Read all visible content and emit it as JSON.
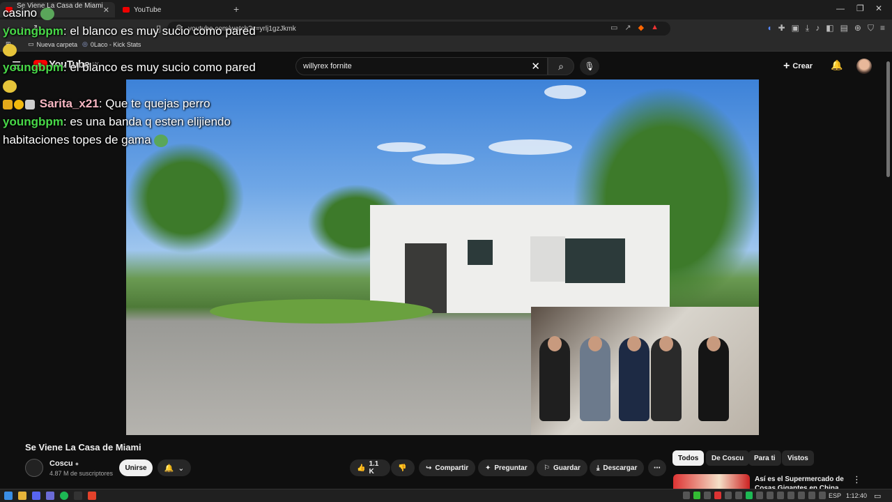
{
  "browser": {
    "tabs": [
      {
        "label": "Se Viene La Casa de Miami -"
      },
      {
        "label": "YouTube"
      }
    ],
    "url": "youtube.com/watch?v=yrlj1gzJkmk",
    "bookmarks": [
      {
        "label": "Nueva carpeta"
      },
      {
        "label": "0Laco - Kick Stats"
      }
    ]
  },
  "youtube": {
    "logo": "YouTube",
    "country": "UY",
    "search_value": "willyrex fornite",
    "create_label": "Crear"
  },
  "chat": [
    {
      "user": "",
      "text": "casino",
      "emote": "frog"
    },
    {
      "user": "youngbpm",
      "text": ": el blanco es muy sucio como pared",
      "emote": "face"
    },
    {
      "user": "youngbpm",
      "text": ": el blanco es muy sucio como pared",
      "emote": "face"
    },
    {
      "user": "Sarita_x21",
      "text": ": Que te quejas perro",
      "emote": ""
    },
    {
      "user": "youngbpm",
      "text": ": es una banda q esten elijiendo habitaciones topes de gama",
      "emote": "frog"
    }
  ],
  "video": {
    "title": "Se Viene La Casa de Miami",
    "channel": "Coscu",
    "subscribers": "4.87 M de suscriptores",
    "join_label": "Unirse",
    "likes": "1.1 K",
    "share_label": "Compartir",
    "ask_label": "Preguntar",
    "save_label": "Guardar",
    "download_label": "Descargar"
  },
  "sidebar": {
    "chips": [
      {
        "label": "Todos"
      },
      {
        "label": "De Coscu"
      },
      {
        "label": "Para ti"
      },
      {
        "label": "Vistos"
      }
    ],
    "recommendation_title": "Así es el Supermercado de Cosas Gigantes en China"
  },
  "taskbar": {
    "language": "ESP",
    "time": "1:12:40"
  }
}
